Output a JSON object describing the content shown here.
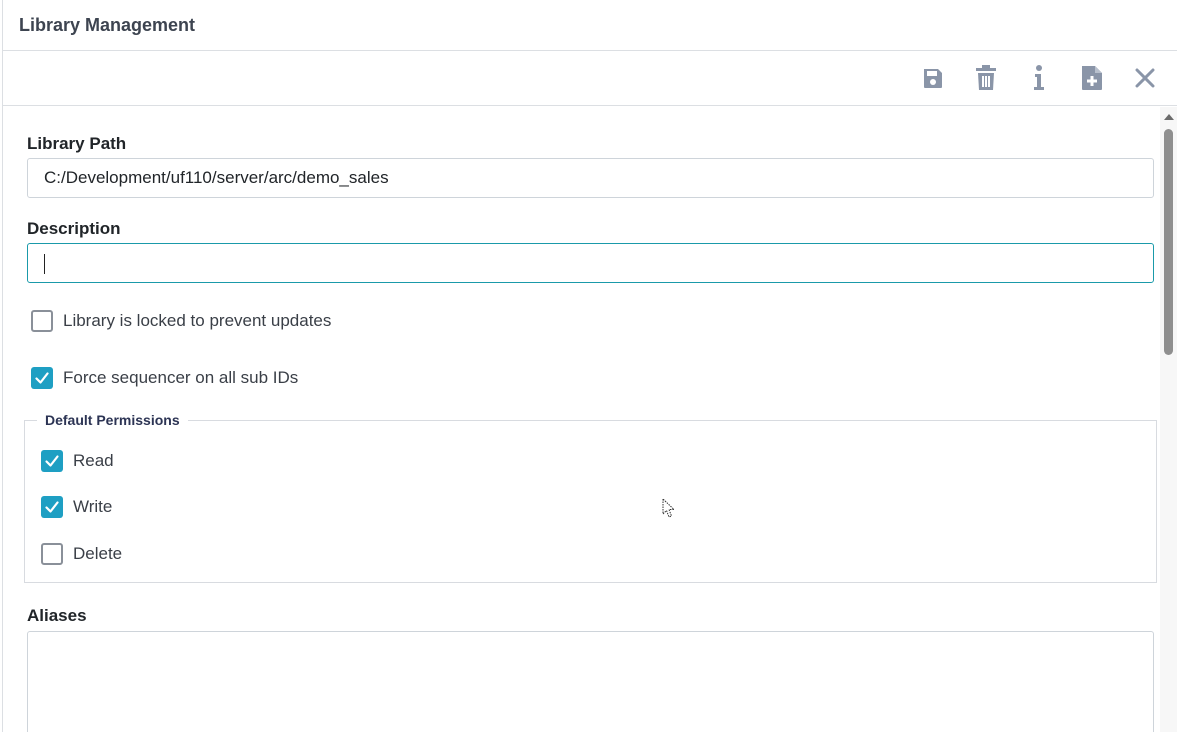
{
  "window": {
    "title": "Library Management"
  },
  "toolbar": {
    "icons": [
      "save-icon",
      "trash-icon",
      "info-icon",
      "new-file-icon",
      "close-icon"
    ],
    "icon_color": "#8a95a8"
  },
  "form": {
    "library_path": {
      "label": "Library Path",
      "value": "C:/Development/uf110/server/arc/demo_sales"
    },
    "description": {
      "label": "Description",
      "value": ""
    },
    "locked": {
      "label": "Library is locked to prevent updates",
      "checked": false
    },
    "force_sequencer": {
      "label": "Force sequencer on all sub IDs",
      "checked": true
    },
    "permissions": {
      "legend": "Default Permissions",
      "read": {
        "label": "Read",
        "checked": true
      },
      "write": {
        "label": "Write",
        "checked": true
      },
      "delete": {
        "label": "Delete",
        "checked": false
      }
    },
    "aliases": {
      "label": "Aliases",
      "value": ""
    }
  },
  "colors": {
    "accent": "#1e9fc3",
    "focus_border": "#1a9aaa",
    "legend_text": "#2c3454"
  }
}
